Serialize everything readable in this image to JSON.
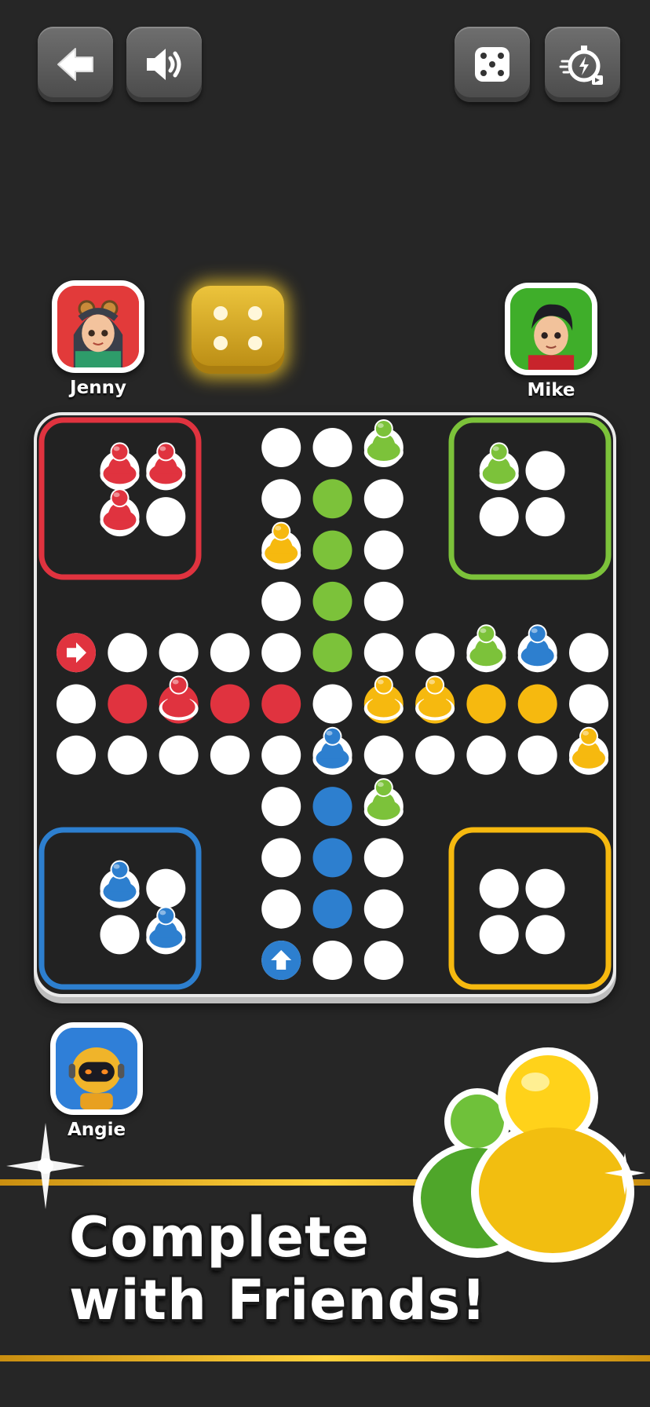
{
  "toolbar": {
    "back_icon": "arrow-left-icon",
    "sound_icon": "speaker-icon",
    "dice_icon": "dice-icon",
    "speed_icon": "stopwatch-lightning-icon"
  },
  "players": {
    "top_left": {
      "name": "Jenny",
      "color": "red",
      "avatar_bg": "#e23a3a"
    },
    "top_right": {
      "name": "Mike",
      "color": "green",
      "avatar_bg": "#3fae2a"
    },
    "bottom_left": {
      "name": "Angie",
      "color": "blue",
      "avatar_bg": "#2f7fd8"
    }
  },
  "active_die": {
    "value": 4,
    "color": "#d9aa22"
  },
  "board": {
    "colors": {
      "red": "#e0333f",
      "green": "#7cc23a",
      "yellow": "#f6b90f",
      "blue": "#2d7fcf"
    },
    "home_yards": {
      "red": {
        "pieces_in_base": 3
      },
      "green": {
        "pieces_in_base": 1
      },
      "blue": {
        "pieces_in_base": 2
      },
      "yellow": {
        "pieces_in_base": 0
      }
    }
  },
  "banner": {
    "line1": "Complete",
    "line2": "with Friends!"
  }
}
